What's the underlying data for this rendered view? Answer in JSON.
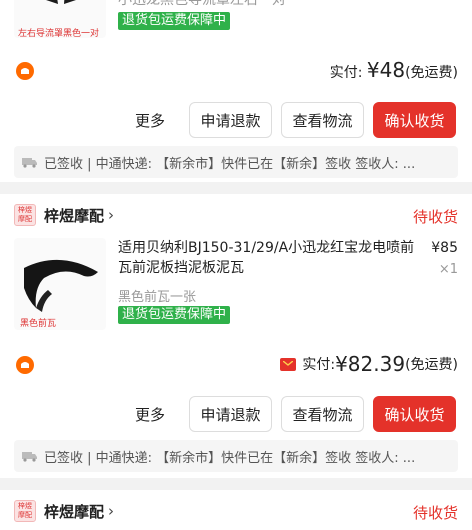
{
  "order1": {
    "thumb_caption": "左右导流罩黑色一对",
    "title_partial": "小迅龙黑色导流罩左右一对",
    "guarantee_tag": "退货包运费保障中",
    "paid_label": "实付:",
    "paid_amount": "¥48",
    "shipping_note": "(免运费)",
    "more_label": "更多",
    "refund_label": "申请退款",
    "logistics_label": "查看物流",
    "confirm_label": "确认收货",
    "logistics_text": "已签收 | 中通快递: 【新余市】快件已在【新余】签收 签收人: ..."
  },
  "order2": {
    "shop_name": "梓煜摩配",
    "shop_logo_text": "梓煜摩配",
    "status": "待收货",
    "thumb_caption": "黑色前瓦",
    "title": "适用贝纳利BJ150-31/29/A小迅龙红宝龙电喷前瓦前泥板挡泥板泥瓦",
    "unit_price": "¥85",
    "qty": "×1",
    "spec": "黑色前瓦一张",
    "guarantee_tag": "退货包运费保障中",
    "paid_label": "实付:",
    "paid_amount": "¥82.39",
    "shipping_note": "(免运费)",
    "more_label": "更多",
    "refund_label": "申请退款",
    "logistics_label": "查看物流",
    "confirm_label": "确认收货",
    "logistics_text": "已签收 | 中通快递: 【新余市】快件已在【新余】签收 签收人: ..."
  },
  "order3": {
    "shop_name": "梓煜摩配",
    "shop_logo_text": "梓煜摩配",
    "status": "待收货"
  },
  "colors": {
    "accent_red": "#e4322a",
    "guarantee_green": "#2fb14a",
    "coupon_orange": "#ff6a00"
  }
}
